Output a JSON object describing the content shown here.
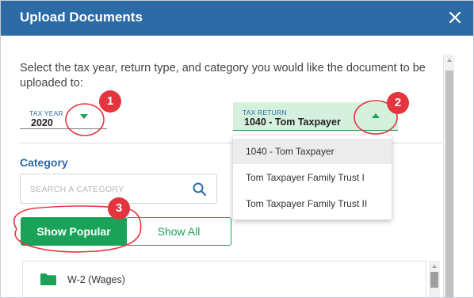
{
  "dialog": {
    "title": "Upload Documents",
    "close_icon": "close-icon"
  },
  "instructions": "Select the tax year, return type, and category you would like the document to be uploaded to:",
  "tax_year": {
    "label": "TAX YEAR",
    "value": "2020",
    "caret_icon": "caret-down-icon"
  },
  "tax_return": {
    "label": "TAX RETURN",
    "value": "1040 - Tom Taxpayer",
    "caret_icon": "caret-up-icon",
    "options": [
      {
        "label": "1040 - Tom Taxpayer",
        "selected": true
      },
      {
        "label": "Tom Taxpayer Family Trust I",
        "selected": false
      },
      {
        "label": "Tom Taxpayer Family Trust II",
        "selected": false
      }
    ]
  },
  "category": {
    "label": "Category",
    "search_placeholder": "SEARCH A CATEGORY",
    "search_value": "",
    "search_icon": "search-icon"
  },
  "buttons": {
    "show_popular": "Show Popular",
    "show_all": "Show All"
  },
  "categories": [
    {
      "label": "W-2 (Wages)",
      "icon": "folder-icon"
    }
  ],
  "annotations": [
    {
      "number": "1"
    },
    {
      "number": "2"
    },
    {
      "number": "3"
    }
  ],
  "colors": {
    "header": "#2d6ba6",
    "accent_green": "#1aa259",
    "selected_field_bg": "#d6f0de",
    "annotation_red": "#e5343d"
  }
}
